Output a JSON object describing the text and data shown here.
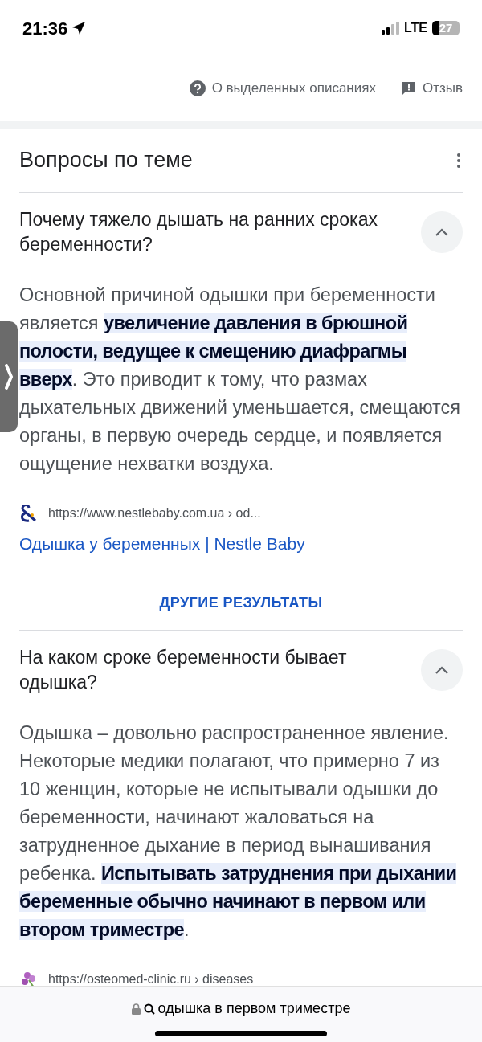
{
  "status_bar": {
    "time": "21:36",
    "network": "LTE",
    "battery": "27"
  },
  "header_links": [
    {
      "kind": "help",
      "label": "О выделенных описаниях"
    },
    {
      "kind": "feedback",
      "label": "Отзыв"
    }
  ],
  "section": {
    "title": "Вопросы по теме",
    "questions": [
      {
        "question": "Почему тяжело дышать на ранних сроках беременности?",
        "expanded": true,
        "answer": [
          {
            "text": "Основной причиной одышки при беременности является ",
            "highlighted": false
          },
          {
            "text": "увеличение давления в брюшной полости, ведущее к смещению диафрагмы вверх",
            "highlighted": true
          },
          {
            "text": ". Это приводит к тому, что размах дыхательных движений уменьшается, смещаются органы, в первую очередь сердце, и появляется ощущение нехватки воздуха.",
            "highlighted": false
          }
        ],
        "source": {
          "url": "https://www.nestlebaby.com.ua › od...",
          "title": "Одышка у беременных | Nestle Baby"
        },
        "more": "ДРУГИЕ РЕЗУЛЬТАТЫ"
      },
      {
        "question": "На каком сроке беременности бывает одышка?",
        "expanded": true,
        "answer": [
          {
            "text": "Одышка – довольно распространенное явление. Некоторые медики полагают, что примерно 7 из 10 женщин, которые не испытывали одышки до беременности, начинают жаловаться на затрудненное дыхание в период вынашивания ребенка. ",
            "highlighted": false
          },
          {
            "text": "Испытывать затруднения при дыхании беременные обычно начинают в первом или втором триместре",
            "highlighted": true
          },
          {
            "text": ".",
            "highlighted": false
          }
        ],
        "source": {
          "url": "https://osteomed-clinic.ru › diseases"
        }
      }
    ]
  },
  "address_bar": {
    "query": "одышка в первом триместре"
  }
}
